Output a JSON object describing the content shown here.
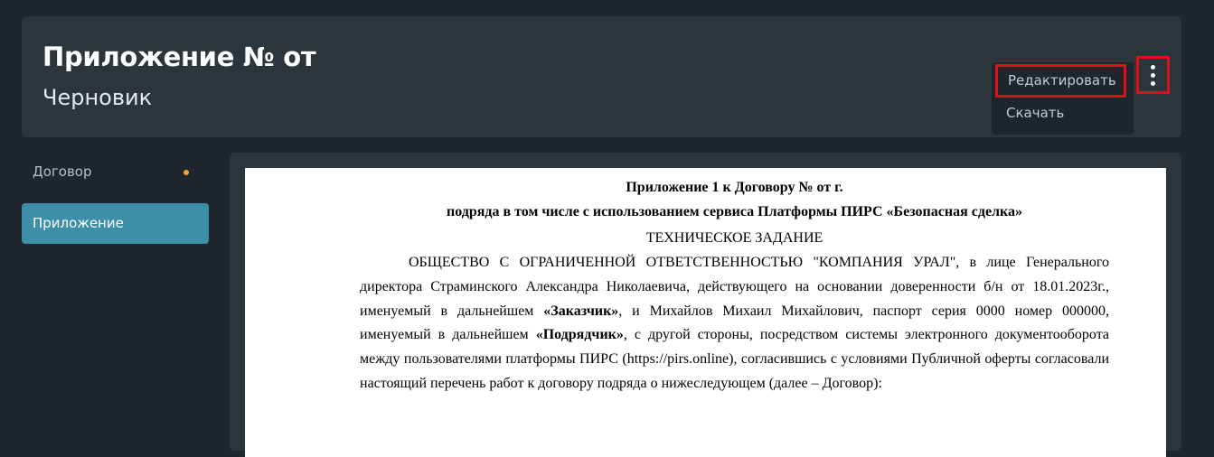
{
  "header": {
    "title": "Приложение № от",
    "subtitle": "Черновик"
  },
  "actions_menu": {
    "icon": "more-vertical-icon",
    "items": {
      "edit": "Редактировать",
      "download": "Скачать"
    }
  },
  "sidebar": {
    "items": [
      {
        "label": "Договор",
        "indicator": "unsaved-dot",
        "indicator_color": "#f0a23a"
      },
      {
        "label": "Приложение",
        "active": true
      }
    ]
  },
  "document": {
    "heading_1": "Приложение 1 к Договору № от г.",
    "heading_2": "подряда в том числе с использованием сервиса Платформы ПИРС «Безопасная сделка»",
    "heading_3": "ТЕХНИЧЕСКОЕ ЗАДАНИЕ",
    "paragraph": {
      "part_1": "ОБЩЕСТВО С ОГРАНИЧЕННОЙ ОТВЕТСТВЕННОСТЬЮ \"КОМПАНИЯ УРАЛ\", в лице Генерального директора Страминского Александра Николаевича, действующего на основании доверенности б/н от 18.01.2023г., именуемый в дальнейшем ",
      "customer": "«Заказчик»",
      "part_2": ", и Михайлов Михаил Михайлович, паспорт серия 0000 номер 000000, именуемый в дальнейшем ",
      "contractor": "«Подрядчик»",
      "part_3": ", с другой стороны, посредством системы электронного документооборота между пользователями платформы ПИРС (https://pirs.online), согласившись с условиями Публичной оферты согласовали настоящий перечень работ к договору подряда о нижеследующем (далее – Договор):"
    }
  },
  "colors": {
    "background": "#1f262d",
    "panel": "#2c343c",
    "active_accent": "#3d8fa8",
    "highlight_border": "#e0101a"
  }
}
